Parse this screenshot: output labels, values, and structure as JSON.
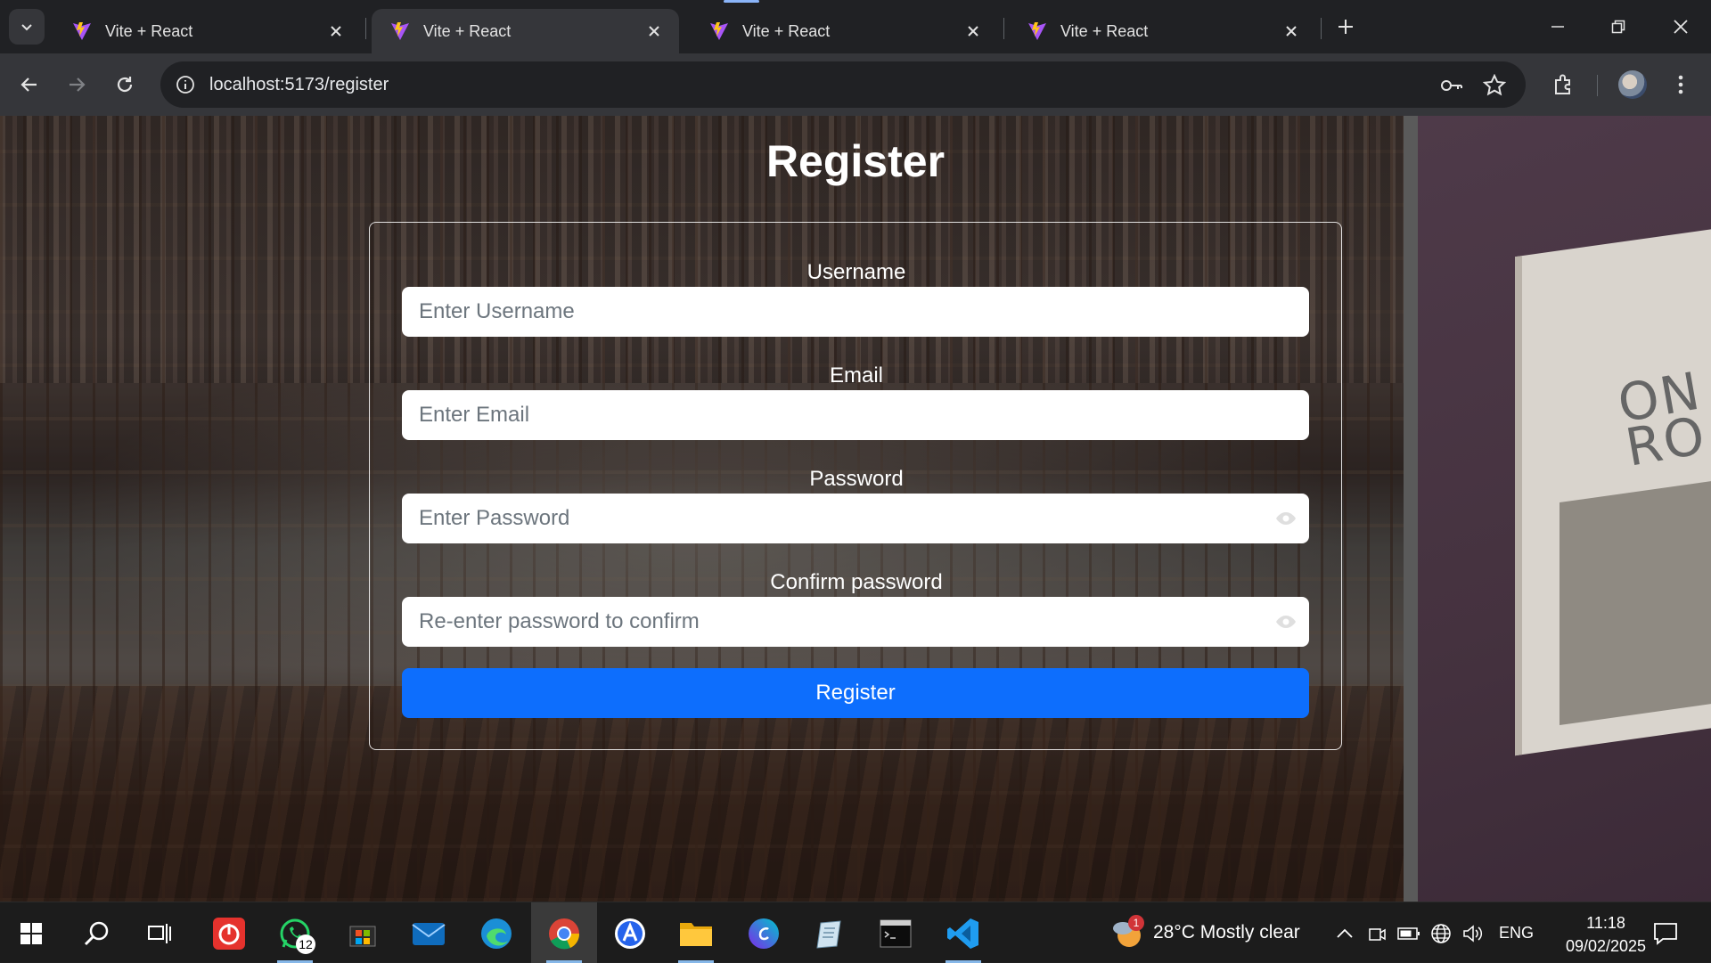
{
  "browser": {
    "tabs": [
      {
        "title": "Vite + React",
        "active": false
      },
      {
        "title": "Vite + React",
        "active": true
      },
      {
        "title": "Vite + React",
        "active": false
      },
      {
        "title": "Vite + React",
        "active": false
      }
    ],
    "url": "localhost:5173/register"
  },
  "page": {
    "title": "Register",
    "fields": [
      {
        "label": "Username",
        "placeholder": "Enter Username"
      },
      {
        "label": "Email",
        "placeholder": "Enter Email"
      },
      {
        "label": "Password",
        "placeholder": "Enter Password"
      },
      {
        "label": "Confirm password",
        "placeholder": "Re-enter password to confirm"
      }
    ],
    "submit_label": "Register",
    "accent_color": "#0d6efd"
  },
  "background": {
    "book_text": "ON RO"
  },
  "taskbar": {
    "whatsapp_badge": "12",
    "weather_badge": "1",
    "weather": "28°C  Mostly clear",
    "language": "ENG",
    "time": "11:18",
    "date": "09/02/2025"
  }
}
